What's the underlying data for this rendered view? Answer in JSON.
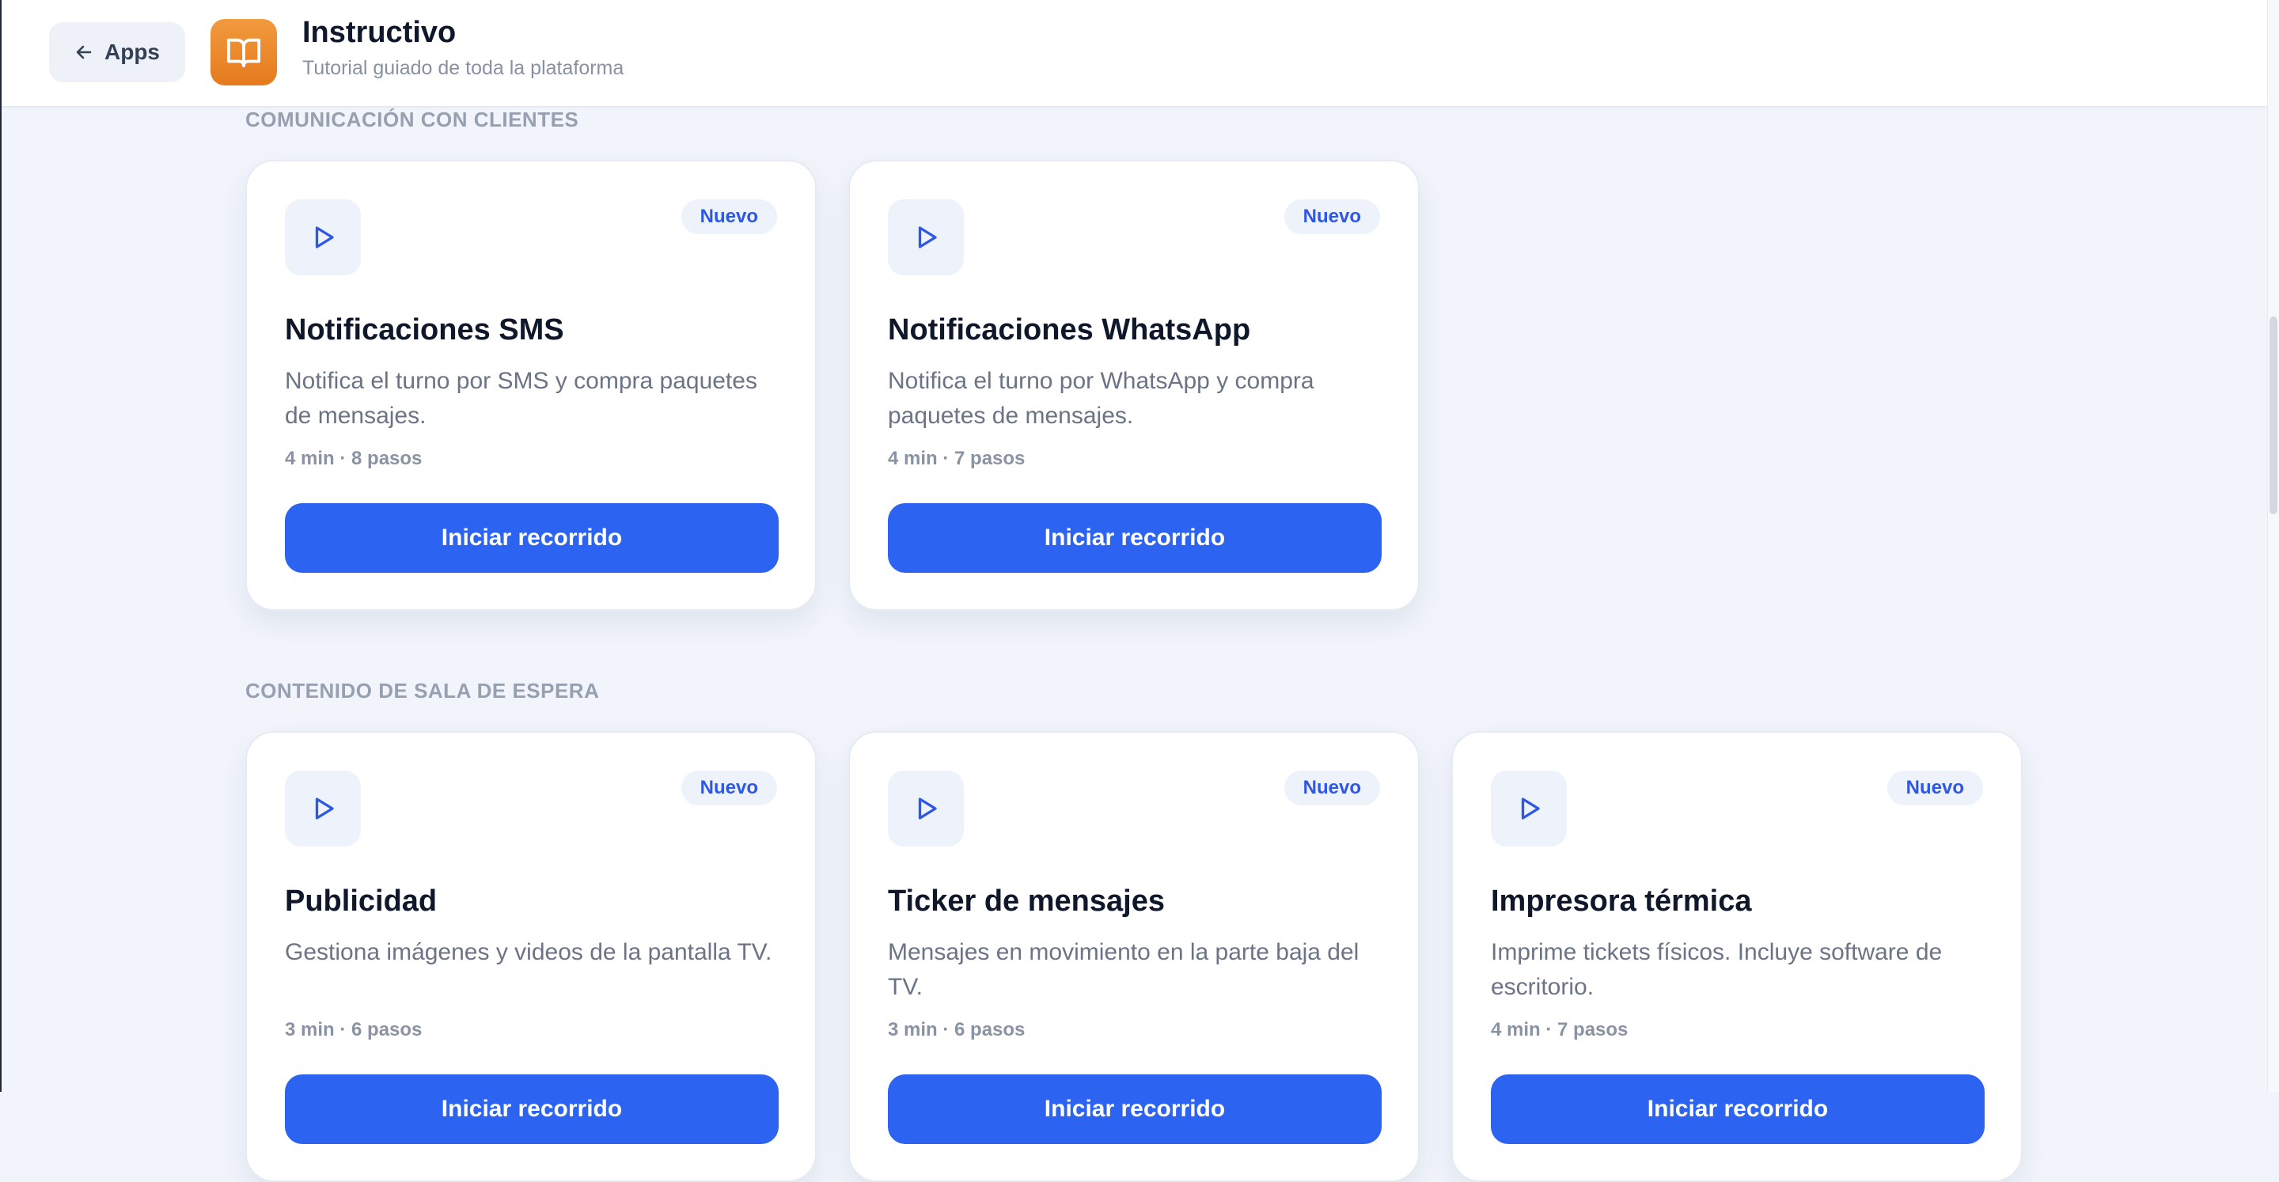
{
  "header": {
    "back_label": "Apps",
    "app_title": "Instructivo",
    "app_subtitle": "Tutorial guiado de toda la plataforma"
  },
  "sections": [
    {
      "title": "COMUNICACIÓN CON CLIENTES",
      "cards": [
        {
          "badge": "Nuevo",
          "title": "Notificaciones SMS",
          "desc": "Notifica el turno por SMS y compra paquetes de mensajes.",
          "meta": "4 min · 8 pasos",
          "button": "Iniciar recorrido"
        },
        {
          "badge": "Nuevo",
          "title": "Notificaciones WhatsApp",
          "desc": "Notifica el turno por WhatsApp y compra paquetes de mensajes.",
          "meta": "4 min · 7 pasos",
          "button": "Iniciar recorrido"
        }
      ]
    },
    {
      "title": "CONTENIDO DE SALA DE ESPERA",
      "cards": [
        {
          "badge": "Nuevo",
          "title": "Publicidad",
          "desc": "Gestiona imágenes y videos de la pantalla TV.",
          "meta": "3 min · 6 pasos",
          "button": "Iniciar recorrido"
        },
        {
          "badge": "Nuevo",
          "title": "Ticker de mensajes",
          "desc": "Mensajes en movimiento en la parte baja del TV.",
          "meta": "3 min · 6 pasos",
          "button": "Iniciar recorrido"
        },
        {
          "badge": "Nuevo",
          "title": "Impresora térmica",
          "desc": "Imprime tickets físicos. Incluye software de escritorio.",
          "meta": "4 min · 7 pasos",
          "button": "Iniciar recorrido"
        }
      ]
    }
  ],
  "colors": {
    "accent": "#2c63f0",
    "app_icon": "#e8842a",
    "background": "#f1f4fb"
  },
  "icons": {
    "back": "arrow-left-icon",
    "app": "open-book-icon",
    "card": "play-icon"
  }
}
